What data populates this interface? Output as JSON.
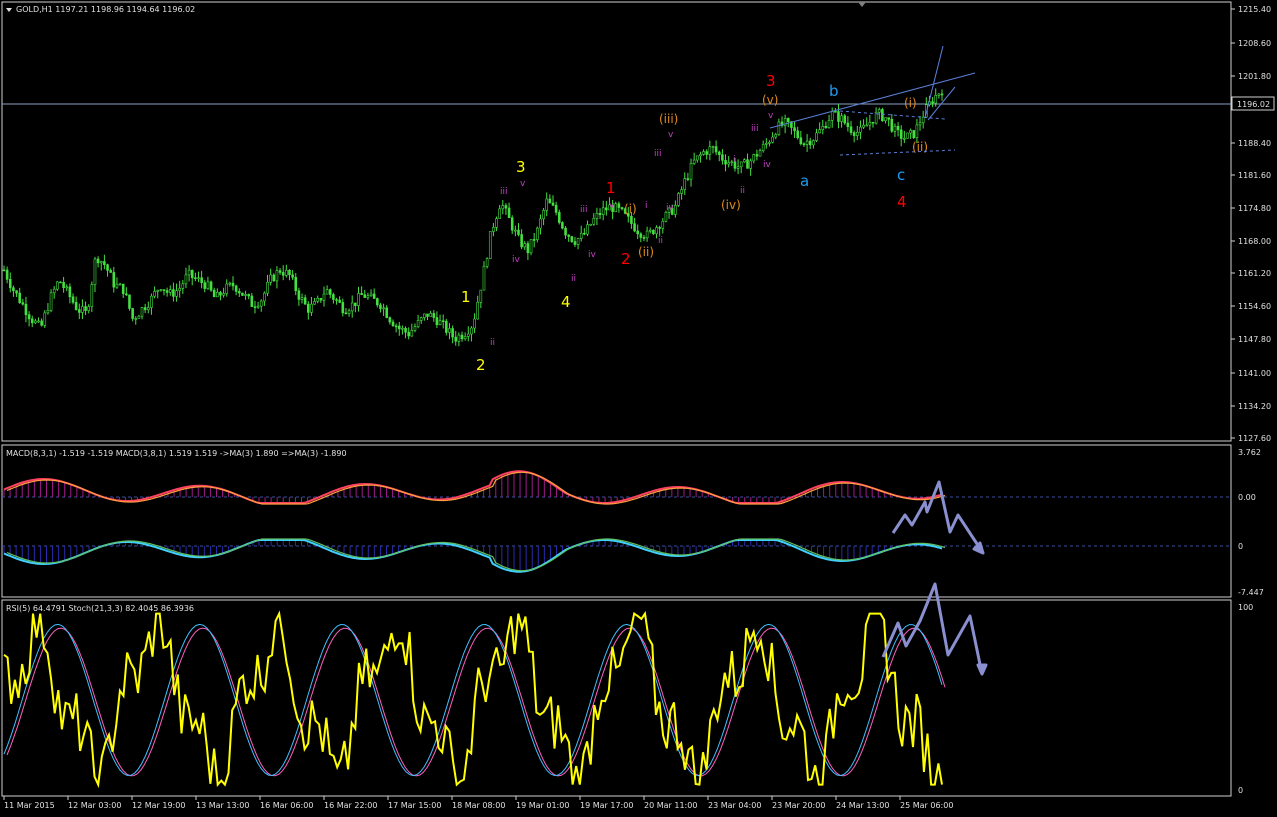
{
  "main": {
    "symbol_header": "GOLD,H1  1197.21 1198.96 1194.64 1196.02",
    "current_price": "1196.02",
    "yticks": [
      "1215.40",
      "1208.60",
      "1201.80",
      "1196.02",
      "1188.40",
      "1181.60",
      "1174.80",
      "1168.00",
      "1161.20",
      "1154.60",
      "1147.80",
      "1141.00",
      "1134.20",
      "1127.60"
    ]
  },
  "macd": {
    "header": "MACD(8,3,1) -1.519 -1.519  MACD(3,8,1) 1.519 1.519  ->MA(3) 1.890  =>MA(3) -1.890",
    "yticks": [
      "3.762",
      "0.00",
      "0",
      "-7.447"
    ]
  },
  "rsi": {
    "header": "RSI(5) 64.4791  Stoch(21,3,3) 82.4045 86.3936",
    "yticks": [
      "100",
      "0"
    ]
  },
  "time_labels": [
    "11 Mar 2015",
    "12 Mar 03:00",
    "12 Mar 19:00",
    "13 Mar 13:00",
    "16 Mar 06:00",
    "16 Mar 22:00",
    "17 Mar 15:00",
    "18 Mar 08:00",
    "19 Mar 01:00",
    "19 Mar 17:00",
    "20 Mar 11:00",
    "23 Mar 04:00",
    "23 Mar 20:00",
    "24 Mar 13:00",
    "25 Mar 06:00"
  ],
  "wave_labels": [
    {
      "t": "1",
      "c": "#ffff00"
    },
    {
      "t": "2",
      "c": "#ffff00"
    },
    {
      "t": "3",
      "c": "#ffff00"
    },
    {
      "t": "4",
      "c": "#ffff00"
    },
    {
      "t": "1",
      "c": "#ff0000"
    },
    {
      "t": "2",
      "c": "#ff0000"
    },
    {
      "t": "3",
      "c": "#ff0000"
    },
    {
      "t": "4",
      "c": "#ff0000"
    },
    {
      "t": "a",
      "c": "#1e9cf0"
    },
    {
      "t": "b",
      "c": "#1e9cf0"
    },
    {
      "t": "c",
      "c": "#1e9cf0"
    },
    {
      "t": "(i)",
      "c": "#e08a1e"
    },
    {
      "t": "(ii)",
      "c": "#e08a1e"
    },
    {
      "t": "(iii)",
      "c": "#e08a1e"
    },
    {
      "t": "(iv)",
      "c": "#e08a1e"
    },
    {
      "t": "(v)",
      "c": "#e08a1e"
    },
    {
      "t": "(i)",
      "c": "#e08a1e"
    },
    {
      "t": "(ii)",
      "c": "#e08a1e"
    },
    {
      "t": "i",
      "c": "#c040c0"
    },
    {
      "t": "ii",
      "c": "#c040c0"
    },
    {
      "t": "iii",
      "c": "#c040c0"
    },
    {
      "t": "iv",
      "c": "#c040c0"
    },
    {
      "t": "v",
      "c": "#c040c0"
    }
  ],
  "chart_data": [
    {
      "type": "candlestick",
      "title": "GOLD,H1",
      "ylim": [
        1127.6,
        1215.4
      ],
      "close_path": [
        1162,
        1158,
        1155,
        1152,
        1150,
        1156,
        1160,
        1157,
        1154,
        1153,
        1165,
        1163,
        1159,
        1158,
        1152,
        1154,
        1156,
        1159,
        1157,
        1158,
        1161,
        1160,
        1159,
        1156,
        1158,
        1159,
        1157,
        1155,
        1156,
        1160,
        1162,
        1161,
        1157,
        1154,
        1155,
        1158,
        1156,
        1154,
        1155,
        1157,
        1156,
        1155,
        1152,
        1150,
        1149,
        1151,
        1153,
        1152,
        1150,
        1148,
        1149,
        1151,
        1160,
        1170,
        1176,
        1172,
        1168,
        1166,
        1170,
        1176,
        1174,
        1170,
        1168,
        1169,
        1172,
        1174,
        1175,
        1174,
        1172,
        1170,
        1169,
        1171,
        1173,
        1175,
        1180,
        1184,
        1186,
        1187,
        1185,
        1184,
        1183,
        1184,
        1186,
        1188,
        1191,
        1192,
        1190,
        1188,
        1189,
        1191,
        1194,
        1193,
        1191,
        1190,
        1192,
        1194,
        1193,
        1190,
        1189,
        1190,
        1194,
        1197,
        1199
      ]
    },
    {
      "type": "line",
      "title": "MACD(8,3,1)",
      "ylim": [
        -7.447,
        3.762
      ]
    },
    {
      "type": "line",
      "title": "RSI(5) / Stoch(21,3,3)",
      "ylim": [
        0,
        100
      ]
    }
  ]
}
